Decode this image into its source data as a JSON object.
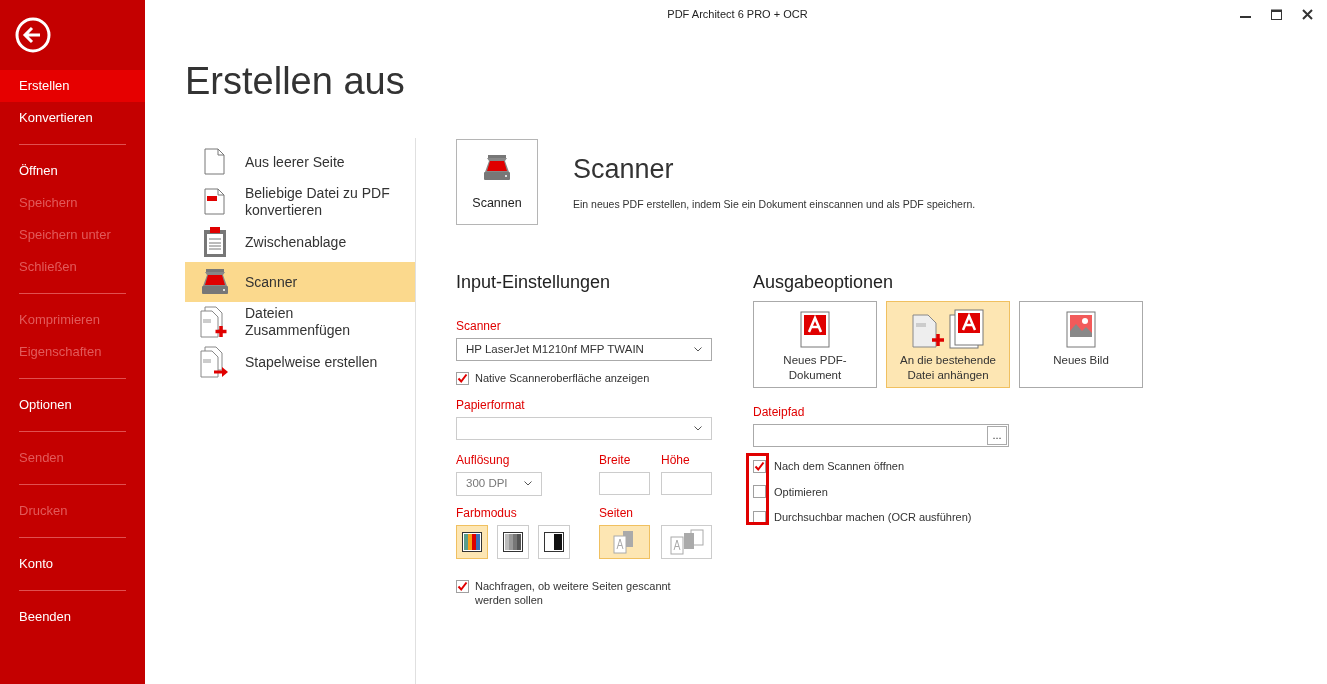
{
  "window": {
    "title": "PDF Architect 6 PRO + OCR"
  },
  "sidebar": {
    "groups": [
      [
        {
          "label": "Erstellen",
          "selected": true,
          "disabled": false
        },
        {
          "label": "Konvertieren",
          "selected": false,
          "disabled": false
        }
      ],
      [
        {
          "label": "Öffnen",
          "selected": false,
          "disabled": false
        },
        {
          "label": "Speichern",
          "selected": false,
          "disabled": true
        },
        {
          "label": "Speichern unter",
          "selected": false,
          "disabled": true
        },
        {
          "label": "Schließen",
          "selected": false,
          "disabled": true
        }
      ],
      [
        {
          "label": "Komprimieren",
          "selected": false,
          "disabled": true
        },
        {
          "label": "Eigenschaften",
          "selected": false,
          "disabled": true
        }
      ],
      [
        {
          "label": "Optionen",
          "selected": false,
          "disabled": false
        }
      ],
      [
        {
          "label": "Senden",
          "selected": false,
          "disabled": true
        }
      ],
      [
        {
          "label": "Drucken",
          "selected": false,
          "disabled": true
        }
      ],
      [
        {
          "label": "Konto",
          "selected": false,
          "disabled": false
        }
      ],
      [
        {
          "label": "Beenden",
          "selected": false,
          "disabled": false
        }
      ]
    ]
  },
  "page_title": "Erstellen aus",
  "sources": [
    {
      "kind": "blank",
      "label": "Aus leerer Seite",
      "selected": false
    },
    {
      "kind": "convert",
      "label": "Beliebige Datei zu PDF konvertieren",
      "selected": false
    },
    {
      "kind": "clipboard",
      "label": "Zwischenablage",
      "selected": false
    },
    {
      "kind": "scanner",
      "label": "Scanner",
      "selected": true
    },
    {
      "kind": "merge",
      "label": "Dateien Zusammenfügen",
      "selected": false
    },
    {
      "kind": "batch",
      "label": "Stapelweise erstellen",
      "selected": false
    }
  ],
  "header": {
    "button": "Scannen",
    "title": "Scanner",
    "description": "Ein neues PDF erstellen, indem Sie ein Dokument einscannen und als PDF speichern."
  },
  "input_settings": {
    "title": "Input-Einstellungen",
    "scanner_label": "Scanner",
    "scanner_value": "HP LaserJet M1210nf MFP TWAIN",
    "native_ui": {
      "label": "Native Scanneroberfläche anzeigen",
      "checked": true
    },
    "paper_label": "Papierformat",
    "resolution_label": "Auflösung",
    "resolution_value": "300 DPI",
    "width_label": "Breite",
    "height_label": "Höhe",
    "color_label": "Farbmodus",
    "color_modes": [
      {
        "kind": "color",
        "selected": true
      },
      {
        "kind": "gray",
        "selected": false
      },
      {
        "kind": "bw",
        "selected": false
      }
    ],
    "pages_label": "Seiten",
    "page_modes": [
      {
        "kind": "single",
        "selected": true
      },
      {
        "kind": "multi",
        "selected": false
      }
    ],
    "ask_more": {
      "label": "Nachfragen, ob weitere Seiten gescannt werden sollen",
      "checked": true
    }
  },
  "output_options": {
    "title": "Ausgabeoptionen",
    "options": [
      {
        "kind": "new_pdf",
        "label": "Neues PDF-Dokument",
        "selected": false
      },
      {
        "kind": "append",
        "label": "An die bestehende Datei anhängen",
        "selected": true
      },
      {
        "kind": "image",
        "label": "Neues Bild",
        "selected": false
      }
    ],
    "path_label": "Dateipfad",
    "browse": "...",
    "checkboxes": [
      {
        "label": "Nach dem Scannen öffnen",
        "checked": true
      },
      {
        "label": "Optimieren",
        "checked": false
      },
      {
        "label": "Durchsuchbar machen (OCR ausführen)",
        "checked": false
      }
    ]
  }
}
